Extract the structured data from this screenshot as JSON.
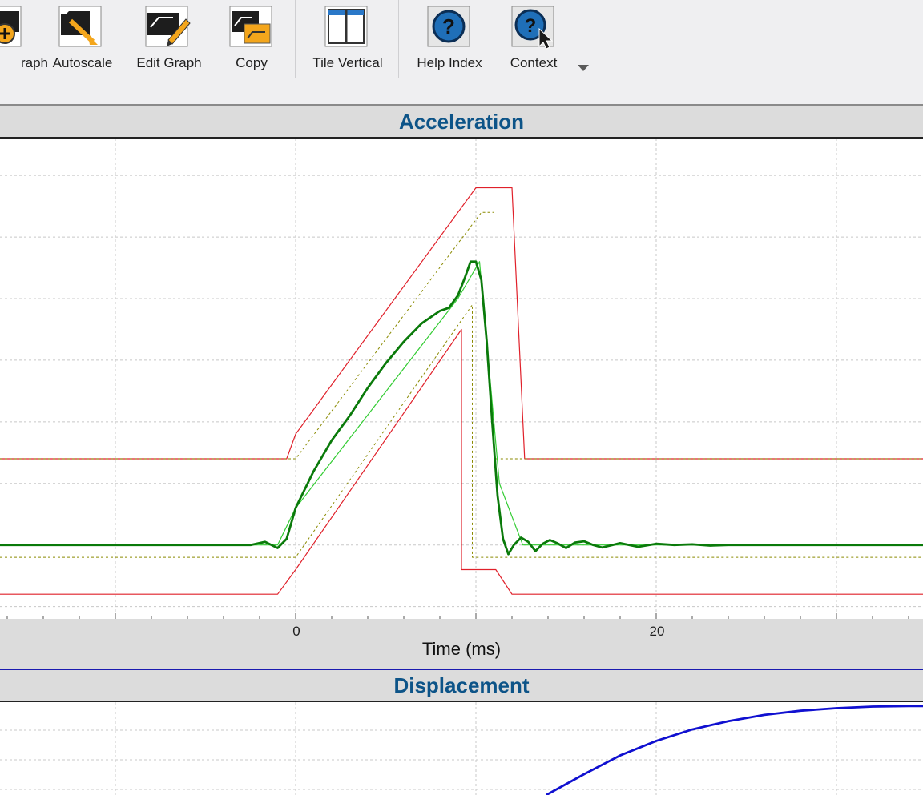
{
  "toolbar": {
    "buttons": [
      {
        "id": "graph",
        "label": "raph",
        "icon": "add-graph-icon"
      },
      {
        "id": "autoscale",
        "label": "Autoscale",
        "icon": "autoscale-icon"
      },
      {
        "id": "edit_graph",
        "label": "Edit Graph",
        "icon": "edit-graph-icon"
      },
      {
        "id": "copy",
        "label": "Copy",
        "icon": "copy-icon"
      },
      {
        "id": "tile_vertical",
        "label": "Tile Vertical",
        "icon": "tile-vertical-icon"
      },
      {
        "id": "help_index",
        "label": "Help Index",
        "icon": "help-icon"
      },
      {
        "id": "context",
        "label": "Context",
        "icon": "context-help-icon"
      }
    ],
    "more_icon": "chevron-down-icon"
  },
  "colors": {
    "title": "#0d5488",
    "tolerance_outer": "#e0202a",
    "tolerance_inner": "#8a8a00",
    "ideal_pulse": "#33cc33",
    "measured": "#0a7a0a",
    "displacement": "#1010d0",
    "header_bg": "#dcdcdc"
  },
  "chart_data": [
    {
      "type": "line",
      "title": "Acceleration",
      "xlabel": "Time (ms)",
      "x_ticks": [
        0,
        20
      ],
      "xlim": [
        -16.4,
        34.8
      ],
      "ylim": [
        -1.2,
        6.6
      ],
      "grid": true,
      "legend": "none",
      "series": [
        {
          "role": "outer_tolerance_upper",
          "x": [
            -16.4,
            -0.5,
            0,
            10,
            12,
            12.7,
            34.8
          ],
          "y": [
            1.4,
            1.4,
            1.8,
            5.8,
            5.8,
            1.4,
            1.4
          ]
        },
        {
          "role": "outer_tolerance_lower",
          "x": [
            -16.4,
            -1,
            0,
            9.2,
            9.2,
            11.1,
            12,
            34.8
          ],
          "y": [
            -0.8,
            -0.8,
            -0.4,
            3.5,
            -0.4,
            -0.4,
            -0.8,
            -0.8
          ]
        },
        {
          "role": "inner_tolerance_upper",
          "x": [
            -16.4,
            0,
            10.3,
            11,
            11,
            34.8
          ],
          "y": [
            1.4,
            1.4,
            5.4,
            5.4,
            1.4,
            1.4
          ]
        },
        {
          "role": "inner_tolerance_lower",
          "x": [
            -16.4,
            0,
            9.8,
            9.8,
            34.8
          ],
          "y": [
            -0.2,
            -0.2,
            3.9,
            -0.2,
            -0.2
          ]
        },
        {
          "role": "ideal_pulse",
          "x": [
            -16.4,
            -1,
            0,
            9,
            10.2,
            11.3,
            12.6,
            34.8
          ],
          "y": [
            0,
            0,
            0.6,
            4.0,
            4.6,
            1.0,
            0,
            0
          ]
        },
        {
          "role": "measured",
          "x": [
            -16.4,
            -10,
            -5,
            -2.5,
            -1.7,
            -1,
            -0.5,
            0,
            1,
            2,
            3,
            4,
            5,
            6,
            7,
            8,
            8.5,
            9,
            9.4,
            9.7,
            10,
            10.3,
            10.6,
            10.9,
            11.2,
            11.5,
            11.8,
            12.1,
            12.5,
            12.9,
            13.3,
            13.7,
            14.1,
            14.5,
            15,
            15.5,
            16,
            16.5,
            17,
            18,
            19,
            20,
            21,
            22,
            23,
            24,
            25,
            34.8
          ],
          "y": [
            0,
            0,
            0,
            0,
            0.05,
            -0.05,
            0.1,
            0.6,
            1.2,
            1.7,
            2.1,
            2.55,
            2.95,
            3.3,
            3.6,
            3.8,
            3.85,
            4.05,
            4.35,
            4.6,
            4.6,
            4.3,
            3.3,
            2.0,
            0.8,
            0.1,
            -0.15,
            0.0,
            0.12,
            0.05,
            -0.1,
            0.02,
            0.08,
            0.03,
            -0.05,
            0.04,
            0.06,
            0.0,
            -0.04,
            0.03,
            -0.03,
            0.02,
            0.0,
            0.01,
            -0.01,
            0.0,
            0.0,
            0.0
          ]
        }
      ]
    },
    {
      "type": "line",
      "title": "Displacement",
      "xlim": [
        -16.4,
        34.8
      ],
      "grid": true,
      "legend": "none",
      "series": [
        {
          "role": "displacement",
          "x": [
            13.9,
            16,
            18,
            20,
            22,
            24,
            26,
            28,
            30,
            32,
            34,
            34.8
          ],
          "y": [
            0.0,
            0.2,
            0.38,
            0.52,
            0.63,
            0.71,
            0.77,
            0.81,
            0.835,
            0.85,
            0.855,
            0.855
          ]
        }
      ]
    }
  ]
}
